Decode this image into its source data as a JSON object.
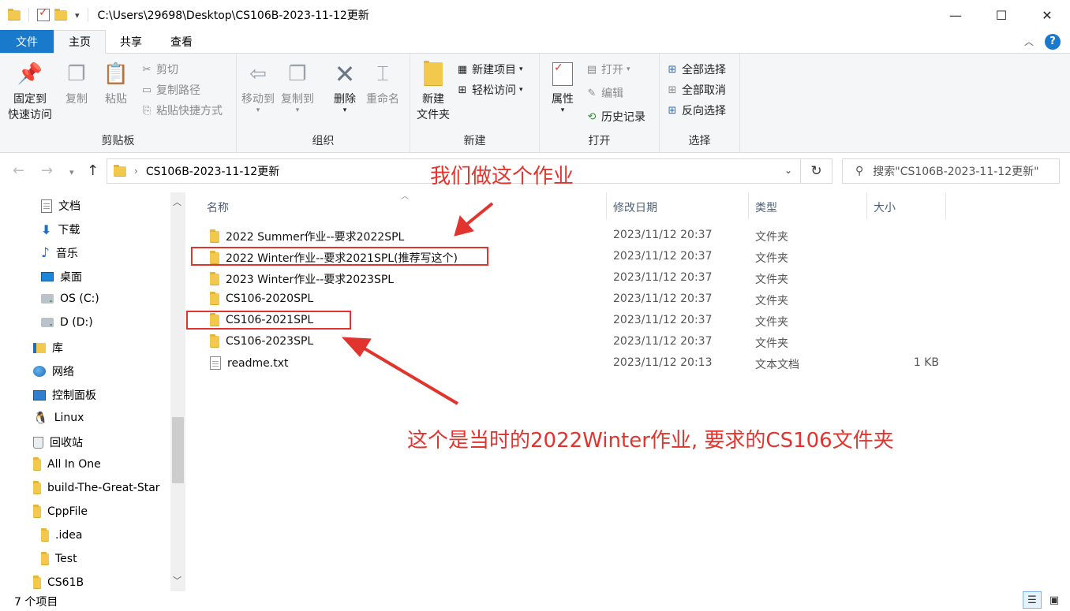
{
  "window": {
    "path": "C:\\Users\\29698\\Desktop\\CS106B-2023-11-12更新",
    "controls": {
      "minimize": "—",
      "maximize": "☐",
      "close": "✕"
    }
  },
  "ribbon_tabs": {
    "file": "文件",
    "home": "主页",
    "share": "共享",
    "view": "查看"
  },
  "ribbon": {
    "clipboard": {
      "label": "剪贴板",
      "pin_line1": "固定到",
      "pin_line2": "快速访问",
      "copy": "复制",
      "paste": "粘贴",
      "cut": "剪切",
      "copy_path": "复制路径",
      "paste_shortcut": "粘贴快捷方式"
    },
    "organize": {
      "label": "组织",
      "move_to": "移动到",
      "copy_to": "复制到",
      "delete": "删除",
      "rename": "重命名"
    },
    "new": {
      "label": "新建",
      "new_folder_line1": "新建",
      "new_folder_line2": "文件夹",
      "new_item": "新建项目",
      "easy_access": "轻松访问"
    },
    "open": {
      "label": "打开",
      "properties": "属性",
      "open": "打开",
      "edit": "编辑",
      "history": "历史记录"
    },
    "select": {
      "label": "选择",
      "select_all": "全部选择",
      "select_none": "全部取消",
      "invert": "反向选择"
    }
  },
  "address": {
    "crumb": "CS106B-2023-11-12更新",
    "search_placeholder": "搜索\"CS106B-2023-11-12更新\""
  },
  "sidebar": {
    "items": [
      {
        "label": "文档",
        "icon": "document-icon"
      },
      {
        "label": "下载",
        "icon": "download-icon"
      },
      {
        "label": "音乐",
        "icon": "music-icon"
      },
      {
        "label": "桌面",
        "icon": "desktop-icon"
      },
      {
        "label": "OS (C:)",
        "icon": "drive-icon"
      },
      {
        "label": "D (D:)",
        "icon": "drive-icon"
      },
      {
        "label": "库",
        "icon": "library-icon"
      },
      {
        "label": "网络",
        "icon": "network-icon"
      },
      {
        "label": "控制面板",
        "icon": "control-panel-icon"
      },
      {
        "label": "Linux",
        "icon": "linux-icon"
      },
      {
        "label": "回收站",
        "icon": "recycle-bin-icon"
      },
      {
        "label": "All In One",
        "icon": "folder-icon"
      },
      {
        "label": "build-The-Great-Star",
        "icon": "folder-icon"
      },
      {
        "label": "CppFile",
        "icon": "folder-icon"
      },
      {
        "label": ".idea",
        "icon": "folder-icon"
      },
      {
        "label": "Test",
        "icon": "folder-icon"
      },
      {
        "label": "CS61B",
        "icon": "folder-icon"
      }
    ]
  },
  "columns": {
    "name": "名称",
    "date": "修改日期",
    "type": "类型",
    "size": "大小"
  },
  "files": [
    {
      "name": "2022 Summer作业--要求2022SPL",
      "date": "2023/11/12 20:37",
      "type": "文件夹",
      "size": "",
      "icon": "folder-icon"
    },
    {
      "name": "2022 Winter作业--要求2021SPL(推荐写这个)",
      "date": "2023/11/12 20:37",
      "type": "文件夹",
      "size": "",
      "icon": "folder-icon"
    },
    {
      "name": "2023 Winter作业--要求2023SPL",
      "date": "2023/11/12 20:37",
      "type": "文件夹",
      "size": "",
      "icon": "folder-icon"
    },
    {
      "name": "CS106-2020SPL",
      "date": "2023/11/12 20:37",
      "type": "文件夹",
      "size": "",
      "icon": "folder-icon"
    },
    {
      "name": "CS106-2021SPL",
      "date": "2023/11/12 20:37",
      "type": "文件夹",
      "size": "",
      "icon": "folder-icon"
    },
    {
      "name": "CS106-2023SPL",
      "date": "2023/11/12 20:37",
      "type": "文件夹",
      "size": "",
      "icon": "folder-icon"
    },
    {
      "name": "readme.txt",
      "date": "2023/11/12 20:13",
      "type": "文本文档",
      "size": "1 KB",
      "icon": "text-file-icon"
    }
  ],
  "annotations": {
    "top": "我们做这个作业",
    "bottom": "这个是当时的2022Winter作业, 要求的CS106文件夹",
    "color": "#e2342e"
  },
  "status": {
    "count": "7 个项目"
  }
}
